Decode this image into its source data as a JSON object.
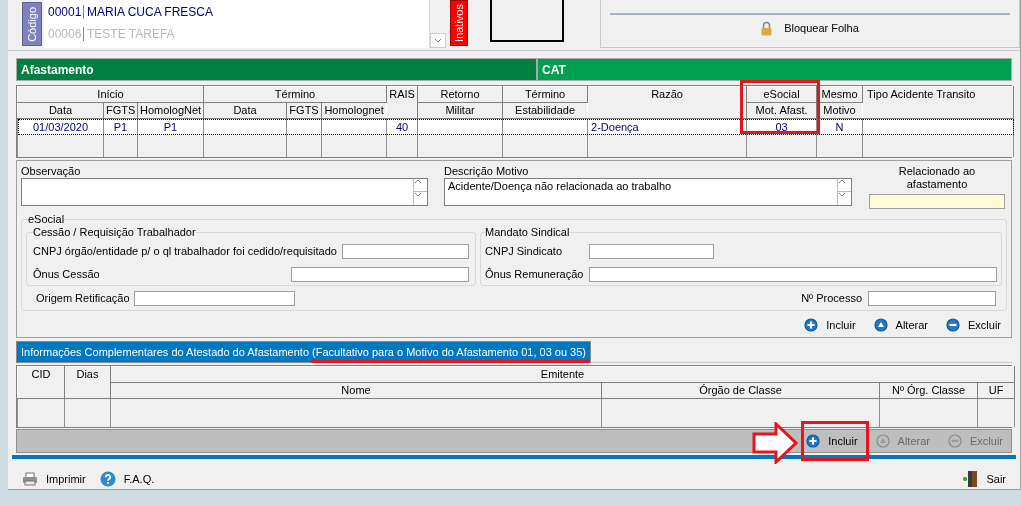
{
  "employees": {
    "tab": "Código",
    "rows": [
      {
        "code": "00001",
        "name": "MARIA CUCA FRESCA",
        "disabled": false
      },
      {
        "code": "00006",
        "name": "TESTE TAREFA",
        "disabled": true
      }
    ],
    "inactive_tab": "Inativos"
  },
  "lock": {
    "label": "Bloquear Folha"
  },
  "tabs": [
    {
      "label": "Afastamento",
      "selected": true
    },
    {
      "label": "CAT",
      "selected": false
    }
  ],
  "leave_grid": {
    "header_groups": [
      {
        "label": "Início",
        "children": [
          "Data",
          "FGTS",
          "HomologNet"
        ]
      },
      {
        "label": "Término",
        "children": [
          "Data",
          "FGTS",
          "Homolognet"
        ]
      },
      {
        "label": "RAIS"
      },
      {
        "label": "Retorno",
        "children": [
          "Militar"
        ]
      },
      {
        "label": "Término",
        "children": [
          "Estabilidade"
        ]
      },
      {
        "label": "Razão"
      },
      {
        "label": "eSocial",
        "children": [
          "Mot. Afast."
        ]
      },
      {
        "label": "Mesmo",
        "children": [
          "Motivo"
        ]
      },
      {
        "label": "Tipo Acidente Transito"
      }
    ],
    "rows": [
      {
        "selected": true,
        "cells": [
          "01/03/2020",
          "P1",
          "P1",
          null,
          null,
          null,
          "40",
          null,
          null,
          "2-Doença",
          "03",
          "N",
          null
        ]
      }
    ]
  },
  "form": {
    "observation": {
      "label": "Observação"
    },
    "reason_description": {
      "label": "Descrição Motivo",
      "value": "Acidente/Doença não relacionada ao trabalho"
    },
    "related": {
      "label": "Relacionado ao afastamento"
    },
    "esocial": {
      "title": "eSocial",
      "assignment": {
        "title": "Cessão / Requisição Trabalhador",
        "fields": [
          {
            "label": "CNPJ órgão/entidade p/ o ql trabalhador foi cedido/requisitado"
          },
          {
            "label": "Ônus Cessão"
          }
        ]
      },
      "union": {
        "title": "Mandato Sindical",
        "fields": [
          {
            "label": "CNPJ Sindicato"
          },
          {
            "label": "Ônus Remuneração"
          }
        ]
      },
      "origin": {
        "label": "Origem Retificação"
      },
      "process": {
        "label": "Nº Processo"
      }
    },
    "actions": [
      {
        "kind": "add",
        "label": "Incluir",
        "disabled": false
      },
      {
        "kind": "edit",
        "label": "Alterar",
        "disabled": false
      },
      {
        "kind": "delete",
        "label": "Excluir",
        "disabled": false
      }
    ]
  },
  "attest_tab": {
    "label": "Informações Complementares do Atestado do Afastamento (Facultativo para o Motivo do Afastamento 01, 03 ou 35)"
  },
  "attest_grid": {
    "header_groups": [
      {
        "label": "CID"
      },
      {
        "label": "Dias"
      },
      {
        "label": "Emitente",
        "children": [
          "Nome",
          "Órgão de  Classe",
          "Nº Órg. Classe",
          "UF"
        ]
      }
    ]
  },
  "attest_actions": [
    {
      "kind": "add",
      "label": "Incluir",
      "disabled": false
    },
    {
      "kind": "edit",
      "label": "Alterar",
      "disabled": true
    },
    {
      "kind": "delete",
      "label": "Excluir",
      "disabled": true
    }
  ],
  "footer": {
    "left": [
      {
        "kind": "print",
        "label": "Imprimir"
      },
      {
        "kind": "help",
        "label": "F.A.Q."
      }
    ],
    "right": [
      {
        "kind": "exit",
        "label": "Sair"
      }
    ]
  }
}
